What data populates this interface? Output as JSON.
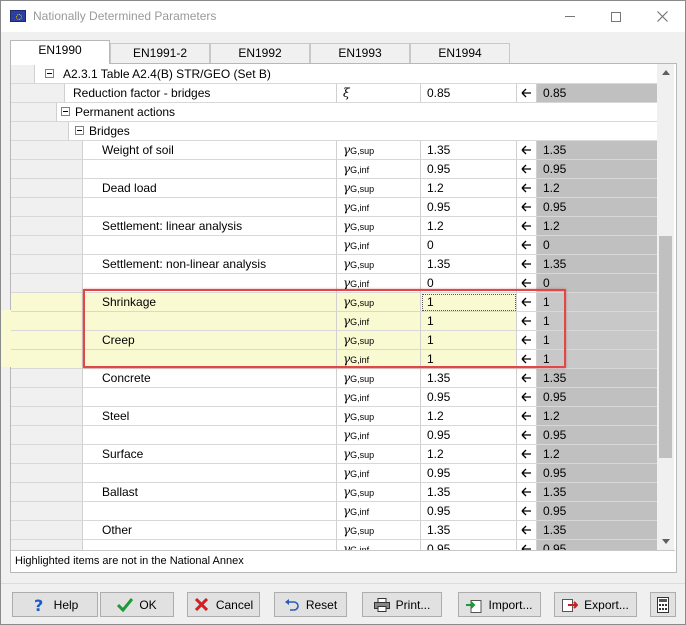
{
  "window": {
    "title": "Nationally Determined Parameters"
  },
  "tabs": [
    {
      "label": "EN1990",
      "active": true
    },
    {
      "label": "EN1991-2",
      "active": false
    },
    {
      "label": "EN1992",
      "active": false
    },
    {
      "label": "EN1993",
      "active": false
    },
    {
      "label": "EN1994",
      "active": false
    }
  ],
  "grid": {
    "section_header": "A2.3.1 Table A2.4(B) STR/GEO (Set B)",
    "reduction": {
      "name": "Reduction factor - bridges",
      "symbol": "ξ",
      "value": "0.85",
      "default": "0.85"
    },
    "permanent_actions": "Permanent actions",
    "bridges": "Bridges",
    "sym_main": "γ",
    "sub_sup": "G,sup",
    "sub_inf": "G,inf",
    "items": [
      {
        "name": "Weight of soil",
        "sup_value": "1.35",
        "sup_default": "1.35",
        "inf_value": "0.95",
        "inf_default": "0.95"
      },
      {
        "name": "Dead load",
        "sup_value": "1.2",
        "sup_default": "1.2",
        "inf_value": "0.95",
        "inf_default": "0.95"
      },
      {
        "name": "Settlement: linear analysis",
        "sup_value": "1.2",
        "sup_default": "1.2",
        "inf_value": "0",
        "inf_default": "0"
      },
      {
        "name": "Settlement: non-linear analysis",
        "sup_value": "1.35",
        "sup_default": "1.35",
        "inf_value": "0",
        "inf_default": "0"
      },
      {
        "name": "Shrinkage",
        "sup_value": "1",
        "sup_default": "1",
        "inf_value": "1",
        "inf_default": "1"
      },
      {
        "name": "Creep",
        "sup_value": "1",
        "sup_default": "1",
        "inf_value": "1",
        "inf_default": "1"
      },
      {
        "name": "Concrete",
        "sup_value": "1.35",
        "sup_default": "1.35",
        "inf_value": "0.95",
        "inf_default": "0.95"
      },
      {
        "name": "Steel",
        "sup_value": "1.2",
        "sup_default": "1.2",
        "inf_value": "0.95",
        "inf_default": "0.95"
      },
      {
        "name": "Surface",
        "sup_value": "1.2",
        "sup_default": "1.2",
        "inf_value": "0.95",
        "inf_default": "0.95"
      },
      {
        "name": "Ballast",
        "sup_value": "1.35",
        "sup_default": "1.35",
        "inf_value": "0.95",
        "inf_default": "0.95"
      },
      {
        "name": "Other",
        "sup_value": "1.35",
        "sup_default": "1.35",
        "inf_value": "0.95",
        "inf_default": "0.95"
      }
    ]
  },
  "status_text": "Highlighted items are not in the National Annex",
  "buttons": {
    "help": "Help",
    "ok": "OK",
    "cancel": "Cancel",
    "reset": "Reset",
    "print": "Print...",
    "import": "Import...",
    "export": "Export..."
  },
  "colors": {
    "highlight": "#fafad2",
    "default_column": "#c0c0c0",
    "annotation_box": "#e04848"
  }
}
